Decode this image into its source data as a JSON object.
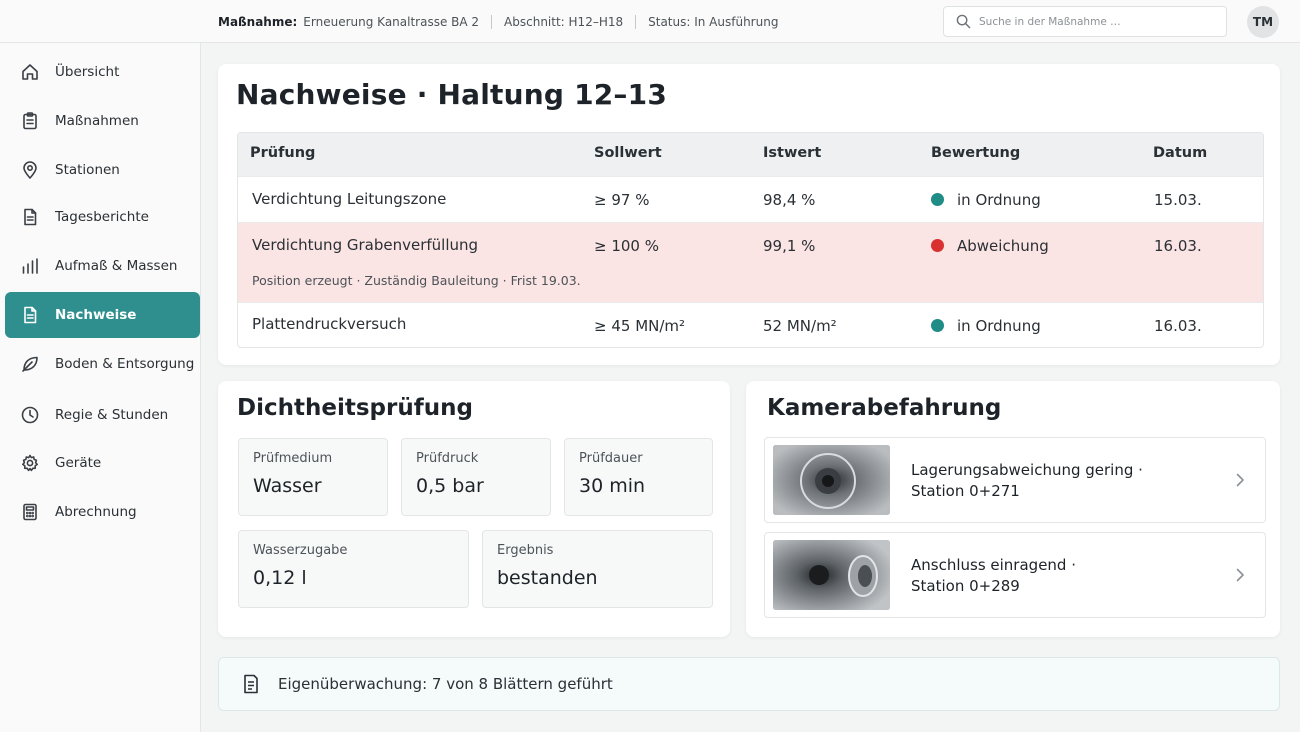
{
  "topbar": {
    "measure_label": "Maßnahme:",
    "measure_value": "Erneuerung Kanaltrasse BA 2",
    "section": "Abschnitt: H12–H18",
    "status": "Status: In Ausführung",
    "search_placeholder": "Suche in der Maßnahme …",
    "avatar_initials": "TM"
  },
  "sidebar": {
    "items": [
      {
        "label": "Übersicht",
        "icon": "home-icon"
      },
      {
        "label": "Maßnahmen",
        "icon": "clipboard-icon"
      },
      {
        "label": "Stationen",
        "icon": "map-pin-icon"
      },
      {
        "label": "Tagesberichte",
        "icon": "document-icon"
      },
      {
        "label": "Aufmaß & Massen",
        "icon": "bar-chart-icon"
      },
      {
        "label": "Nachweise",
        "icon": "document-icon",
        "active": true
      },
      {
        "label": "Boden & Entsorgung",
        "icon": "leaf-icon"
      },
      {
        "label": "Regie & Stunden",
        "icon": "clock-icon"
      },
      {
        "label": "Geräte",
        "icon": "gear-icon"
      },
      {
        "label": "Abrechnung",
        "icon": "calculator-icon"
      }
    ]
  },
  "main": {
    "title": "Nachweise · Haltung 12–13",
    "table": {
      "headers": [
        "Prüfung",
        "Sollwert",
        "Istwert",
        "Bewertung",
        "Datum"
      ],
      "rows": [
        {
          "test": "Verdichtung Leitungszone",
          "target": "≥ 97 %",
          "actual": "98,4 %",
          "rating": "in Ordnung",
          "status": "ok",
          "date": "15.03.",
          "note": ""
        },
        {
          "test": "Verdichtung Grabenverfüllung",
          "target": "≥ 100 %",
          "actual": "99,1 %",
          "rating": "Abweichung",
          "status": "deviation",
          "date": "16.03.",
          "note": "Position erzeugt · Zuständig Bauleitung · Frist 19.03."
        },
        {
          "test": "Plattendruckversuch",
          "target": "≥ 45 MN/m²",
          "actual": "52 MN/m²",
          "rating": "in Ordnung",
          "status": "ok",
          "date": "16.03.",
          "note": ""
        }
      ]
    }
  },
  "dicht": {
    "title": "Dichtheitsprüfung",
    "stats": [
      {
        "label": "Prüfmedium",
        "value": "Wasser"
      },
      {
        "label": "Prüfdruck",
        "value": "0,5 bar"
      },
      {
        "label": "Prüfdauer",
        "value": "30 min"
      },
      {
        "label": "Wasserzugabe",
        "value": "0,12 l"
      },
      {
        "label": "Ergebnis",
        "value": "bestanden"
      }
    ]
  },
  "kamera": {
    "title": "Kamerabefahrung",
    "findings": [
      {
        "line1": "Lagerungsabweichung gering ·",
        "line2": "Station 0+271"
      },
      {
        "line1": "Anschluss einragend ·",
        "line2": "Station 0+289"
      }
    ]
  },
  "banner": {
    "text": "Eigenüberwachung: 7 von 8 Blättern geführt"
  },
  "colors": {
    "accent": "#2f8f8f",
    "ok": "#1f8c86",
    "deviation": "#d93030",
    "warn_row": "#fbe4e4"
  }
}
